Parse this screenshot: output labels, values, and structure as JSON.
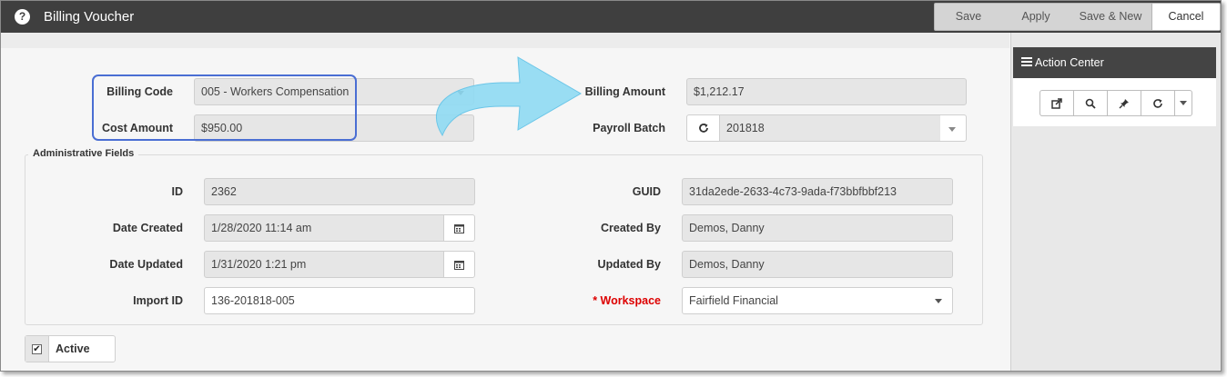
{
  "window": {
    "title": "Billing Voucher"
  },
  "toolbar": {
    "save": "Save",
    "apply": "Apply",
    "save_new": "Save & New",
    "cancel": "Cancel"
  },
  "form": {
    "billing_code": {
      "label": "Billing Code",
      "value": "005 - Workers Compensation"
    },
    "cost_amount": {
      "label": "Cost Amount",
      "value": "$950.00"
    },
    "billing_amount": {
      "label": "Billing Amount",
      "value": "$1,212.17"
    },
    "payroll_batch": {
      "label": "Payroll Batch",
      "value": "201818"
    }
  },
  "admin": {
    "legend": "Administrative Fields",
    "id": {
      "label": "ID",
      "value": "2362"
    },
    "guid": {
      "label": "GUID",
      "value": "31da2ede-2633-4c73-9ada-f73bbfbbf213"
    },
    "date_created": {
      "label": "Date Created",
      "value": "1/28/2020 11:14 am"
    },
    "created_by": {
      "label": "Created By",
      "value": "Demos, Danny"
    },
    "date_updated": {
      "label": "Date Updated",
      "value": "1/31/2020 1:21 pm"
    },
    "updated_by": {
      "label": "Updated By",
      "value": "Demos, Danny"
    },
    "import_id": {
      "label": "Import ID",
      "value": "136-201818-005"
    },
    "workspace": {
      "required_mark": "* ",
      "label": "Workspace",
      "value": "Fairfield Financial"
    }
  },
  "active": {
    "label": "Active",
    "checked": true,
    "check_glyph": "✔"
  },
  "action_center": {
    "title": "Action Center",
    "icons": [
      "open-external-icon",
      "search-icon",
      "pin-icon",
      "refresh-icon",
      "chevron-down-icon"
    ]
  },
  "help": {
    "glyph": "?"
  },
  "colors": {
    "titlebar": "#3f3f3f",
    "highlight_border": "#4a6ed3",
    "arrow": "#8fdaf3",
    "required": "#dd0000"
  }
}
